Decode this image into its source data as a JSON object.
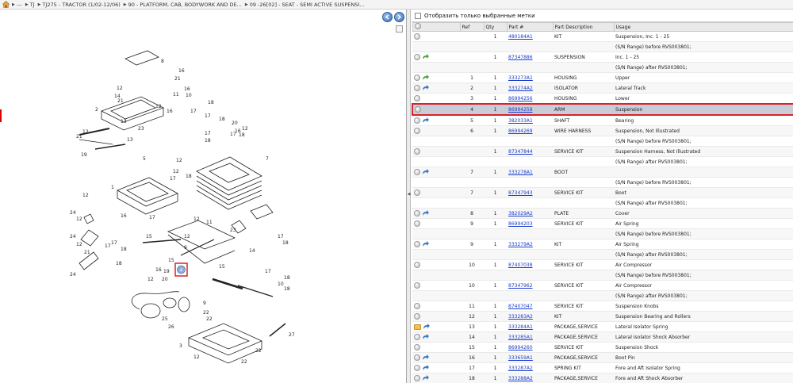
{
  "breadcrumb": [
    {
      "label": "---"
    },
    {
      "label": "TJ"
    },
    {
      "label": "TJ275 - TRACTOR (1/02-12/06)"
    },
    {
      "label": "90 - PLATFORM, CAB, BODYWORK AND DE..."
    },
    {
      "label": "09 -26[02] - SEAT - SEMI ACTIVE SUSPENSI..."
    }
  ],
  "filter": {
    "label": "Отобразить только выбранные метки"
  },
  "table": {
    "headers": [
      "",
      "Ref",
      "Qty",
      "Part #",
      "Part Description",
      "Usage"
    ],
    "rows": [
      {
        "icons": [
          "dot"
        ],
        "ref": "",
        "qty": "1",
        "part": "480184A1",
        "desc": "KIT",
        "usage": "Suspension, Inc. 1 - 25"
      },
      {
        "icons": [],
        "ref": "",
        "qty": "",
        "part": "",
        "desc": "",
        "usage": "(S/N Range) before RVS003801;"
      },
      {
        "icons": [
          "dot",
          "arrow-green"
        ],
        "ref": "",
        "qty": "1",
        "part": "87347886",
        "desc": "SUSPENSION",
        "usage": "Inc. 1 - 25"
      },
      {
        "icons": [],
        "ref": "",
        "qty": "",
        "part": "",
        "desc": "",
        "usage": "(S/N Range) after RVS003801;"
      },
      {
        "icons": [
          "dot",
          "arrow-green"
        ],
        "ref": "1",
        "qty": "1",
        "part": "333273A1",
        "desc": "HOUSING",
        "usage": "Upper"
      },
      {
        "icons": [
          "dot",
          "arrow-blue"
        ],
        "ref": "2",
        "qty": "1",
        "part": "333274A2",
        "desc": "ISOLATOR",
        "usage": "Lateral Track"
      },
      {
        "icons": [
          "dot"
        ],
        "ref": "3",
        "qty": "1",
        "part": "86994256",
        "desc": "HOUSING",
        "usage": "Lower"
      },
      {
        "icons": [
          "dot"
        ],
        "ref": "4",
        "qty": "1",
        "part": "86994258",
        "desc": "ARM",
        "usage": "Suspension",
        "selected": true
      },
      {
        "icons": [
          "dot",
          "arrow-blue"
        ],
        "ref": "5",
        "qty": "1",
        "part": "382033A1",
        "desc": "SHAFT",
        "usage": "Bearing"
      },
      {
        "icons": [
          "dot"
        ],
        "ref": "6",
        "qty": "1",
        "part": "86994269",
        "desc": "WIRE HARNESS",
        "usage": "Suspension, Not Illustrated"
      },
      {
        "icons": [],
        "ref": "",
        "qty": "",
        "part": "",
        "desc": "",
        "usage": "(S/N Range) before RVS003801;"
      },
      {
        "icons": [
          "dot"
        ],
        "ref": "",
        "qty": "1",
        "part": "87347844",
        "desc": "SERVICE KIT",
        "usage": "Suspension Harness, Not Illustrated"
      },
      {
        "icons": [],
        "ref": "",
        "qty": "",
        "part": "",
        "desc": "",
        "usage": "(S/N Range) after RVS003801;"
      },
      {
        "icons": [
          "dot",
          "arrow-blue"
        ],
        "ref": "7",
        "qty": "1",
        "part": "333278A1",
        "desc": "BOOT",
        "usage": ""
      },
      {
        "icons": [],
        "ref": "",
        "qty": "",
        "part": "",
        "desc": "",
        "usage": "(S/N Range) before RVS003801;"
      },
      {
        "icons": [
          "dot"
        ],
        "ref": "7",
        "qty": "1",
        "part": "87347943",
        "desc": "SERVICE KIT",
        "usage": "Boot"
      },
      {
        "icons": [],
        "ref": "",
        "qty": "",
        "part": "",
        "desc": "",
        "usage": "(S/N Range) after RVS003801;"
      },
      {
        "icons": [
          "dot",
          "arrow-blue"
        ],
        "ref": "8",
        "qty": "1",
        "part": "382029A2",
        "desc": "PLATE",
        "usage": "Cover"
      },
      {
        "icons": [
          "dot"
        ],
        "ref": "9",
        "qty": "1",
        "part": "86994203",
        "desc": "SERVICE KIT",
        "usage": "Air Spring"
      },
      {
        "icons": [],
        "ref": "",
        "qty": "",
        "part": "",
        "desc": "",
        "usage": "(S/N Range) before RVS003801;"
      },
      {
        "icons": [
          "dot",
          "arrow-blue"
        ],
        "ref": "9",
        "qty": "1",
        "part": "333279A2",
        "desc": "KIT",
        "usage": "Air Spring"
      },
      {
        "icons": [],
        "ref": "",
        "qty": "",
        "part": "",
        "desc": "",
        "usage": "(S/N Range) after RVS003801;"
      },
      {
        "icons": [
          "dot"
        ],
        "ref": "10",
        "qty": "1",
        "part": "87407038",
        "desc": "SERVICE KIT",
        "usage": "Air Compressor"
      },
      {
        "icons": [],
        "ref": "",
        "qty": "",
        "part": "",
        "desc": "",
        "usage": "(S/N Range) before RVS003801;"
      },
      {
        "icons": [
          "dot"
        ],
        "ref": "10",
        "qty": "1",
        "part": "87347962",
        "desc": "SERVICE KIT",
        "usage": "Air Compressor"
      },
      {
        "icons": [],
        "ref": "",
        "qty": "",
        "part": "",
        "desc": "",
        "usage": "(S/N Range) after RVS003801;"
      },
      {
        "icons": [
          "dot"
        ],
        "ref": "11",
        "qty": "1",
        "part": "87407047",
        "desc": "SERVICE KIT",
        "usage": "Suspension Knobs"
      },
      {
        "icons": [
          "dot"
        ],
        "ref": "12",
        "qty": "1",
        "part": "333283A2",
        "desc": "KIT",
        "usage": "Suspension Bearing and Rollers"
      },
      {
        "icons": [
          "folder",
          "arrow-blue"
        ],
        "ref": "13",
        "qty": "1",
        "part": "333284A1",
        "desc": "PACKAGE,SERVICE",
        "usage": "Lateral Isolator Spring"
      },
      {
        "icons": [
          "dot",
          "arrow-blue"
        ],
        "ref": "14",
        "qty": "1",
        "part": "333285A1",
        "desc": "PACKAGE,SERVICE",
        "usage": "Lateral Isolator Shock Absorber"
      },
      {
        "icons": [
          "dot"
        ],
        "ref": "15",
        "qty": "1",
        "part": "86994260",
        "desc": "SERVICE KIT",
        "usage": "Suspension Shock"
      },
      {
        "icons": [
          "dot",
          "arrow-blue"
        ],
        "ref": "16",
        "qty": "1",
        "part": "333659A1",
        "desc": "PACKAGE,SERVICE",
        "usage": "Boot Pin"
      },
      {
        "icons": [
          "dot",
          "arrow-blue"
        ],
        "ref": "17",
        "qty": "1",
        "part": "333287A2",
        "desc": "SPRING KIT",
        "usage": "Fore and Aft Isolator Spring"
      },
      {
        "icons": [
          "dot",
          "arrow-blue"
        ],
        "ref": "18",
        "qty": "1",
        "part": "333288A2",
        "desc": "PACKAGE,SERVICE",
        "usage": "Fore and Aft Shock Absorber"
      }
    ]
  },
  "diagram": {
    "callouts": [
      "8",
      "16",
      "21",
      "12",
      "14",
      "16",
      "21",
      "11",
      "10",
      "18",
      "12",
      "13",
      "2",
      "16",
      "17",
      "17",
      "18",
      "23",
      "12",
      "21",
      "20",
      "12",
      "16",
      "17",
      "18",
      "7",
      "12",
      "17",
      "18",
      "19",
      "13",
      "12",
      "17",
      "18",
      "5",
      "1",
      "24",
      "12",
      "16",
      "17",
      "18",
      "24",
      "12",
      "21",
      "17",
      "18",
      "12",
      "11",
      "23",
      "15",
      "12",
      "9",
      "17",
      "18",
      "14",
      "15",
      "16",
      "12",
      "19",
      "15",
      "20",
      "4",
      "18",
      "10",
      "9",
      "17",
      "18",
      "22",
      "25",
      "26",
      "22",
      "3",
      "12",
      "22",
      "22",
      "27"
    ],
    "highlighted_callout": "4"
  },
  "colors": {
    "selection_border": "#d8232a",
    "selection_fill": "#c9cdd8",
    "link": "#1a3cc8",
    "nav_button": "#3a6fb6"
  }
}
